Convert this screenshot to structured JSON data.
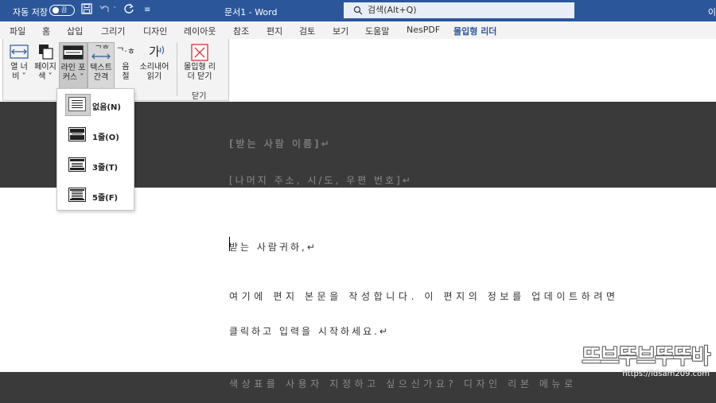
{
  "titlebar": {
    "autosave_label": "자동 저장",
    "toggle_state": "끔",
    "document_title": "문서1  -  Word",
    "search_placeholder": "검색(Alt+Q)",
    "right_edge_text": "이",
    "bg_color": "#2b579a"
  },
  "tabs": [
    {
      "label": "파일"
    },
    {
      "label": "홈"
    },
    {
      "label": "삽입"
    },
    {
      "label": "그리기"
    },
    {
      "label": "디자인"
    },
    {
      "label": "레이아웃"
    },
    {
      "label": "참조"
    },
    {
      "label": "편지"
    },
    {
      "label": "검토"
    },
    {
      "label": "보기"
    },
    {
      "label": "도움말"
    },
    {
      "label": "NesPDF"
    },
    {
      "label": "몰입형 리더"
    }
  ],
  "ribbon": {
    "buttons": [
      {
        "label_1": "열 너",
        "label_2": "비 ˅"
      },
      {
        "label_1": "페이지",
        "label_2": "색 ˅"
      },
      {
        "label_1": "라인 포",
        "label_2": "커스 ˅"
      },
      {
        "label_1": "텍스트",
        "label_2": "간격"
      },
      {
        "label_1": "음",
        "label_2": "절"
      },
      {
        "label_1": "소리내어",
        "label_2": "읽기"
      },
      {
        "label_1": "몰입형 리",
        "label_2": "더 닫기"
      }
    ],
    "glyphs": {
      "syllable": "ᄀ·ㅎ",
      "read_aloud": "가"
    },
    "close_group_label": "닫기"
  },
  "line_focus_menu": {
    "items": [
      {
        "label": "없음(N)"
      },
      {
        "label": "1줄(O)"
      },
      {
        "label": "3줄(T)"
      },
      {
        "label": "5줄(F)"
      }
    ]
  },
  "document": {
    "recipient_name": "[받는 사람 이름]↵",
    "address": "[나머지 주소, 시/도, 우편 번호]↵",
    "salutation": "받는 사람귀하,↵",
    "body_line_1": "여기에 편지 본문을 작성합니다. 이 편지의 정보를 업데이트하려면",
    "body_line_2": "클릭하고 입력을 시작하세요.↵",
    "body_line_3": "색상표를 사용자 지정하고 싶으신가요? 디자인 리본 메뉴로"
  },
  "watermark": {
    "logo": "뜨브뚜브뚜뚜바",
    "url": "https://ldsam209.com"
  }
}
